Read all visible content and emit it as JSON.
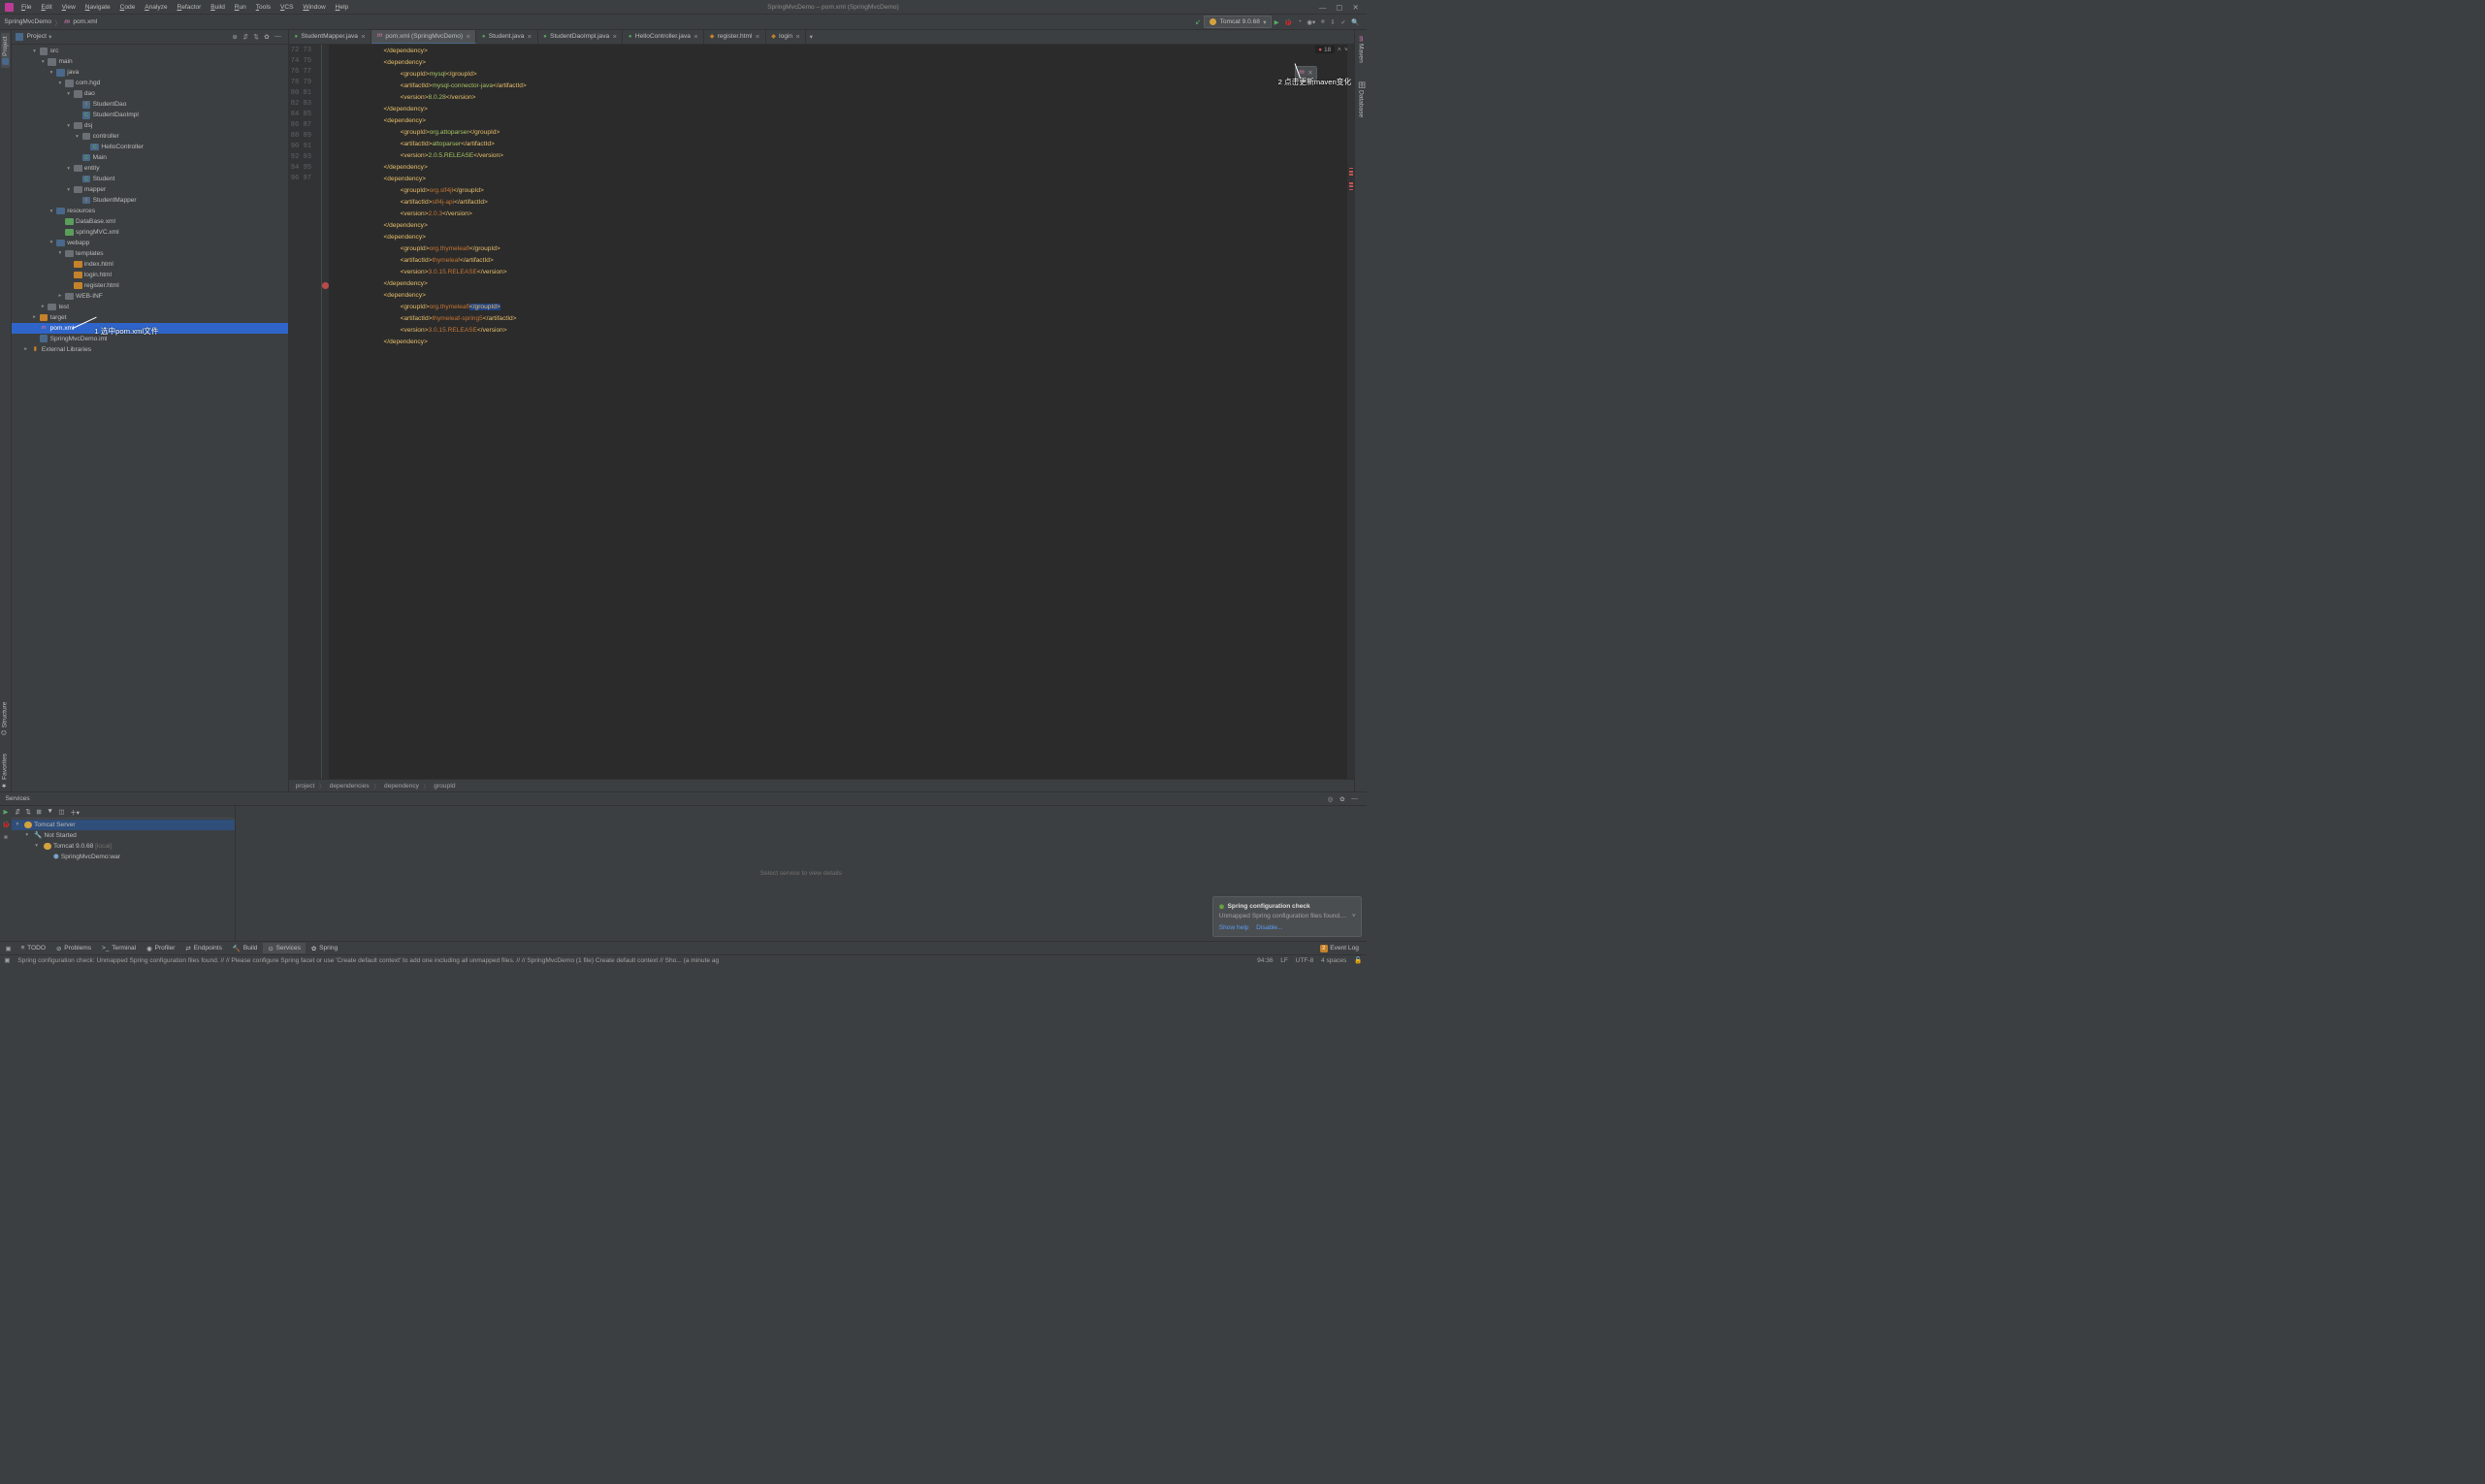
{
  "window": {
    "title": "SpringMvcDemo – pom.xml (SpringMvcDemo)"
  },
  "menu": [
    "File",
    "Edit",
    "View",
    "Navigate",
    "Code",
    "Analyze",
    "Refactor",
    "Build",
    "Run",
    "Tools",
    "VCS",
    "Window",
    "Help"
  ],
  "breadcrumb_top": {
    "project": "SpringMvcDemo",
    "file": "pom.xml"
  },
  "run_config": "Tomcat 9.0.68",
  "left_tabs": [
    "Project",
    "Structure",
    "Favorites"
  ],
  "right_tabs": [
    "Maven",
    "Database"
  ],
  "project_panel_label": "Project",
  "tree": [
    {
      "d": 2,
      "a": "d",
      "i": "folder",
      "t": "src"
    },
    {
      "d": 3,
      "a": "d",
      "i": "folder",
      "t": "main"
    },
    {
      "d": 4,
      "a": "d",
      "i": "folder-blue",
      "t": "java"
    },
    {
      "d": 5,
      "a": "d",
      "i": "folder",
      "t": "com.hgd"
    },
    {
      "d": 6,
      "a": "d",
      "i": "folder",
      "t": "dao"
    },
    {
      "d": 7,
      "a": "n",
      "i": "intf",
      "t": "StudentDao"
    },
    {
      "d": 7,
      "a": "n",
      "i": "class",
      "t": "StudentDaoImpl"
    },
    {
      "d": 6,
      "a": "d",
      "i": "folder",
      "t": "dsj"
    },
    {
      "d": 7,
      "a": "d",
      "i": "folder",
      "t": "controller"
    },
    {
      "d": 8,
      "a": "n",
      "i": "class",
      "t": "HelloController"
    },
    {
      "d": 7,
      "a": "n",
      "i": "class",
      "t": "Main"
    },
    {
      "d": 6,
      "a": "d",
      "i": "folder",
      "t": "entity"
    },
    {
      "d": 7,
      "a": "n",
      "i": "class",
      "t": "Student"
    },
    {
      "d": 6,
      "a": "d",
      "i": "folder",
      "t": "mapper"
    },
    {
      "d": 7,
      "a": "n",
      "i": "intf",
      "t": "StudentMapper"
    },
    {
      "d": 4,
      "a": "d",
      "i": "folder-blue",
      "t": "resources"
    },
    {
      "d": 5,
      "a": "n",
      "i": "xml",
      "t": "DataBase.xml"
    },
    {
      "d": 5,
      "a": "n",
      "i": "xml",
      "t": "springMVC.xml"
    },
    {
      "d": 4,
      "a": "d",
      "i": "folder-blue",
      "t": "webapp"
    },
    {
      "d": 5,
      "a": "d",
      "i": "folder",
      "t": "templates"
    },
    {
      "d": 6,
      "a": "n",
      "i": "html",
      "t": "index.html"
    },
    {
      "d": 6,
      "a": "n",
      "i": "html",
      "t": "login.html"
    },
    {
      "d": 6,
      "a": "n",
      "i": "html",
      "t": "register.html"
    },
    {
      "d": 5,
      "a": "r",
      "i": "folder",
      "t": "WEB-INF"
    },
    {
      "d": 3,
      "a": "r",
      "i": "folder",
      "t": "test"
    },
    {
      "d": 2,
      "a": "r",
      "i": "folder-orange",
      "t": "target"
    },
    {
      "d": 2,
      "a": "n",
      "i": "pom",
      "t": "pom.xml",
      "sel": true
    },
    {
      "d": 2,
      "a": "n",
      "i": "iml",
      "t": "SpringMvcDemo.iml"
    },
    {
      "d": 1,
      "a": "r",
      "i": "lib",
      "t": "External Libraries"
    }
  ],
  "annot1": "1 选中pom.xml文件",
  "annot2": "2 点击更新maven变化",
  "editor_tabs": [
    {
      "icon": "class",
      "label": "StudentMapper.java"
    },
    {
      "icon": "pom",
      "label": "pom.xml (SpringMvcDemo)",
      "active": true
    },
    {
      "icon": "class",
      "label": "Student.java"
    },
    {
      "icon": "class",
      "label": "StudentDaoImpl.java"
    },
    {
      "icon": "class",
      "label": "HelloController.java"
    },
    {
      "icon": "html",
      "label": "register.html"
    },
    {
      "icon": "html",
      "label": "login"
    }
  ],
  "editor_inspect": {
    "errors": "18"
  },
  "code_lines": [
    {
      "n": 72,
      "html": "            <span class='tag'>&lt;/dependency&gt;</span>"
    },
    {
      "n": 73,
      "html": "            <span class='tag'>&lt;dependency&gt;</span>"
    },
    {
      "n": 74,
      "html": "                <span class='tag'>&lt;groupId&gt;</span><span class='val'>mysql</span><span class='tag'>&lt;/groupId&gt;</span>"
    },
    {
      "n": 75,
      "html": "                <span class='tag'>&lt;artifactId&gt;</span><span class='val'>mysql-connector-java</span><span class='tag'>&lt;/artifactId&gt;</span>"
    },
    {
      "n": 76,
      "html": "                <span class='tag'>&lt;version&gt;</span><span class='val'>8.0.28</span><span class='tag'>&lt;/version&gt;</span>"
    },
    {
      "n": 77,
      "html": "            <span class='tag'>&lt;/dependency&gt;</span>"
    },
    {
      "n": 78,
      "html": "            <span class='tag'>&lt;dependency&gt;</span>"
    },
    {
      "n": 79,
      "html": "                <span class='tag'>&lt;groupId&gt;</span><span class='val'>org.attoparser</span><span class='tag'>&lt;/groupId&gt;</span>"
    },
    {
      "n": 80,
      "html": "                <span class='tag'>&lt;artifactId&gt;</span><span class='val'>attoparser</span><span class='tag'>&lt;/artifactId&gt;</span>"
    },
    {
      "n": 81,
      "html": "                <span class='tag'>&lt;version&gt;</span><span class='val'>2.0.5.RELEASE</span><span class='tag'>&lt;/version&gt;</span>"
    },
    {
      "n": 82,
      "html": "            <span class='tag'>&lt;/dependency&gt;</span>"
    },
    {
      "n": 83,
      "html": "            <span class='tag'>&lt;dependency&gt;</span>"
    },
    {
      "n": 84,
      "html": "                <span class='tag'>&lt;groupId&gt;</span><span class='val-red'>org.slf4jl</span><span class='tag'>&lt;/groupId&gt;</span>"
    },
    {
      "n": 85,
      "html": "                <span class='tag'>&lt;artifactId&gt;</span><span class='val-red'>slf4j-api</span><span class='tag'>&lt;/artifactId&gt;</span>"
    },
    {
      "n": 86,
      "html": "                <span class='tag'>&lt;version&gt;</span><span class='val-red'>2.0.3</span><span class='tag'>&lt;/version&gt;</span>"
    },
    {
      "n": 87,
      "html": "            <span class='tag'>&lt;/dependency&gt;</span>"
    },
    {
      "n": 88,
      "html": "            <span class='tag'>&lt;dependency&gt;</span>"
    },
    {
      "n": 89,
      "html": "                <span class='tag'>&lt;groupId&gt;</span><span class='val-red'>org.thymeleafl</span><span class='tag'>&lt;/groupId&gt;</span>"
    },
    {
      "n": 90,
      "html": "                <span class='tag'>&lt;artifactId&gt;</span><span class='val-red'>thymeleaf</span><span class='tag'>&lt;/artifactId&gt;</span>"
    },
    {
      "n": 91,
      "html": "                <span class='tag'>&lt;version&gt;</span><span class='val-red'>3.0.15.RELEASE</span><span class='tag'>&lt;/version&gt;</span>"
    },
    {
      "n": 92,
      "html": "            <span class='tag'>&lt;/dependency&gt;</span>"
    },
    {
      "n": 93,
      "html": "            <span class='tag'>&lt;dependency&gt;</span>"
    },
    {
      "n": 94,
      "html": "                <span class='tag'>&lt;groupId&gt;</span><span class='val-red'>org.thymeleafl</span><span class='tag hl'>&lt;/groupId&gt;</span>",
      "err": true
    },
    {
      "n": 95,
      "html": "                <span class='tag'>&lt;artifactId&gt;</span><span class='val-red'>thymeleaf-spring5</span><span class='tag'>&lt;/artifactId&gt;</span>"
    },
    {
      "n": 96,
      "html": "                <span class='tag'>&lt;version&gt;</span><span class='val-red'>3.0.15.RELEASE</span><span class='tag'>&lt;/version&gt;</span>"
    },
    {
      "n": 97,
      "html": "            <span class='tag'>&lt;/dependency&gt;</span>"
    }
  ],
  "breadcrumb_editor": [
    "project",
    "dependencies",
    "dependency",
    "groupId"
  ],
  "services": {
    "title": "Services",
    "tree": [
      {
        "d": 0,
        "a": "d",
        "i": "tom",
        "t": "Tomcat Server",
        "sel": true
      },
      {
        "d": 1,
        "a": "d",
        "i": "wrench",
        "t": "Not Started"
      },
      {
        "d": 2,
        "a": "d",
        "i": "tom",
        "t": "Tomcat 9.0.68",
        "suffix": "[local]"
      },
      {
        "d": 3,
        "a": "n",
        "i": "art",
        "t": "SpringMvcDemo:war"
      }
    ],
    "placeholder": "Select service to view details"
  },
  "notification": {
    "title": "Spring configuration check",
    "body": "Unmapped Spring configuration files found....",
    "links": [
      "Show help",
      "Disable..."
    ]
  },
  "bottom_tabs": [
    {
      "icon": "≡",
      "label": "TODO"
    },
    {
      "icon": "⊘",
      "label": "Problems"
    },
    {
      "icon": ">_",
      "label": "Terminal"
    },
    {
      "icon": "◉",
      "label": "Profiler"
    },
    {
      "icon": "⇄",
      "label": "Endpoints"
    },
    {
      "icon": "🔨",
      "label": "Build"
    },
    {
      "icon": "⊙",
      "label": "Services",
      "active": true
    },
    {
      "icon": "✿",
      "label": "Spring"
    }
  ],
  "event_log": {
    "badge": "2",
    "label": "Event Log"
  },
  "status": {
    "msg": "Spring configuration check: Unmapped Spring configuration files found. // // Please configure Spring facet or use 'Create default context' to add one including all unmapped files. // // SpringMvcDemo (1 file)   Create default context // Sho... (a minute ag",
    "pos": "94:36",
    "le": "LF",
    "enc": "UTF-8",
    "indent": "4 spaces"
  }
}
